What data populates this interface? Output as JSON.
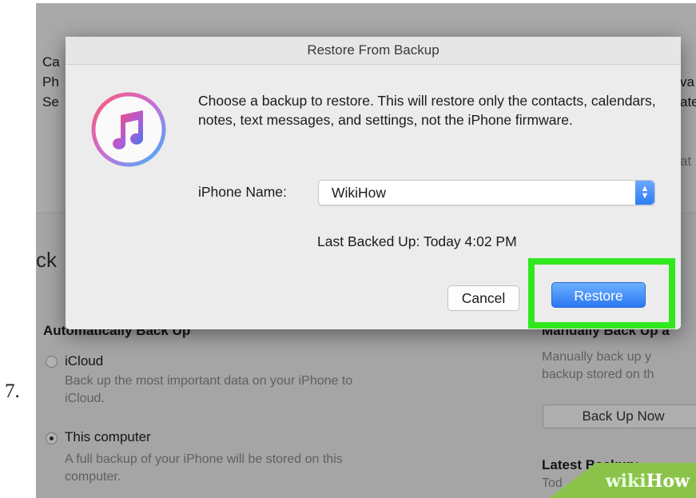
{
  "step": {
    "number": "7."
  },
  "background": {
    "top_labels": [
      "Ca",
      "Ph",
      "Se"
    ],
    "top_right": [
      "va",
      "ate",
      "at"
    ],
    "heading": "ck",
    "auto_backup": {
      "title": "Automatically Back Up",
      "icloud": {
        "label": "iCloud",
        "desc_line1": "Back up the most important data on your iPhone to",
        "desc_line2": "iCloud."
      },
      "computer": {
        "label": "This computer",
        "desc_line1": "A full backup of your iPhone will be stored on this",
        "desc_line2": "computer."
      }
    },
    "manual": {
      "title": "Manually Back Up a",
      "desc_line1": "Manually back up y",
      "desc_line2": "backup stored on th",
      "button": "Back Up Now",
      "latest_label": "Latest Backup:",
      "latest_value": "Tod"
    }
  },
  "dialog": {
    "title": "Restore From Backup",
    "message": "Choose a backup to restore. This will restore only the contacts, calendars, notes, text messages, and settings, not the iPhone firmware.",
    "name_label": "iPhone Name:",
    "selected_device": "WikiHow",
    "last_backed_up": "Last Backed Up: Today 4:02 PM",
    "cancel_label": "Cancel",
    "restore_label": "Restore"
  },
  "watermark": {
    "part1": "wiki",
    "part2": "How"
  },
  "colors": {
    "highlight": "#30e81d",
    "accent": "#2f7df5",
    "watermark": "#8bc34a"
  }
}
